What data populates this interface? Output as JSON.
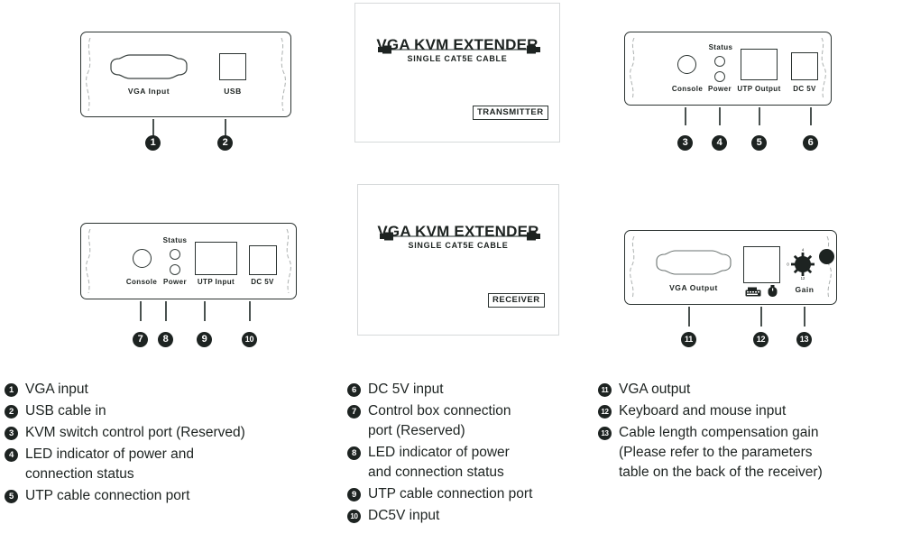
{
  "panels": {
    "transmitter_front": {
      "name": "Transmitter front panel",
      "ports": [
        {
          "label": "VGA Input",
          "type": "vga"
        },
        {
          "label": "USB",
          "type": "square"
        }
      ],
      "callouts": [
        {
          "number": "1"
        },
        {
          "number": "2"
        }
      ]
    },
    "transmitter_rear": {
      "name": "Transmitter rear panel",
      "status_label": "Status",
      "ports": [
        {
          "label": "Console",
          "type": "circle"
        },
        {
          "label": "Power",
          "type": "leds"
        },
        {
          "label": "UTP Output",
          "type": "rj45"
        },
        {
          "label": "DC 5V",
          "type": "square"
        }
      ],
      "callouts": [
        {
          "number": "3"
        },
        {
          "number": "4"
        },
        {
          "number": "5"
        },
        {
          "number": "6"
        }
      ]
    },
    "receiver_rear": {
      "name": "Receiver rear panel",
      "status_label": "Status",
      "ports": [
        {
          "label": "Console",
          "type": "circle"
        },
        {
          "label": "Power",
          "type": "leds"
        },
        {
          "label": "UTP Input",
          "type": "rj45"
        },
        {
          "label": "DC 5V",
          "type": "square"
        }
      ],
      "callouts": [
        {
          "number": "7"
        },
        {
          "number": "8"
        },
        {
          "number": "9"
        },
        {
          "number": "10"
        }
      ]
    },
    "receiver_front": {
      "name": "Receiver front panel",
      "ports": [
        {
          "label": "VGA Output",
          "type": "vga"
        },
        {
          "label": "",
          "type": "usb-km"
        },
        {
          "label": "Gain",
          "type": "knob"
        }
      ],
      "callouts": [
        {
          "number": "11"
        },
        {
          "number": "12"
        },
        {
          "number": "13"
        }
      ]
    }
  },
  "product_boxes": [
    {
      "title": "VGA KVM EXTENDER",
      "subtitle": "SINGLE CAT5E CABLE",
      "tag": "TRANSMITTER"
    },
    {
      "title": "VGA KVM EXTENDER",
      "subtitle": "SINGLE CAT5E CABLE",
      "tag": "RECEIVER"
    }
  ],
  "legend": {
    "column1": [
      {
        "number": "1",
        "text": "VGA input"
      },
      {
        "number": "2",
        "text": "USB cable in"
      },
      {
        "number": "3",
        "text": "KVM switch control port (Reserved)"
      },
      {
        "number": "4",
        "text": "LED indicator of power and\nconnection status"
      },
      {
        "number": "5",
        "text": "UTP cable connection port"
      }
    ],
    "column2": [
      {
        "number": "6",
        "text": "DC 5V input"
      },
      {
        "number": "7",
        "text": "Control box connection\nport (Reserved)"
      },
      {
        "number": "8",
        "text": "LED indicator of power\nand connection status"
      },
      {
        "number": "9",
        "text": "UTP cable connection port"
      },
      {
        "number": "10",
        "text": "DC5V input"
      }
    ],
    "column3": [
      {
        "number": "11",
        "text": "VGA output"
      },
      {
        "number": "12",
        "text": "Keyboard and mouse input"
      },
      {
        "number": "13",
        "text": "Cable length compensation gain\n (Please refer to the parameters\n  table on the back of the receiver)"
      }
    ]
  },
  "colors": {
    "ink": "#1d2321",
    "line": "#2b3331",
    "box_border": "#d6d9da",
    "background": "#ffffff"
  }
}
